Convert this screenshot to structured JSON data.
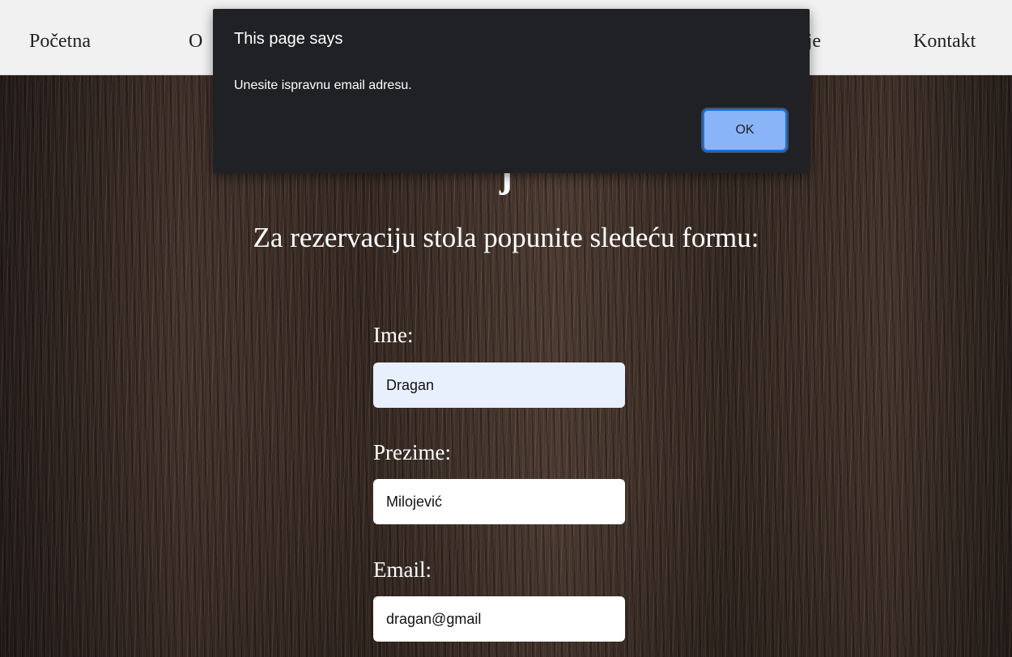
{
  "nav": {
    "items": [
      {
        "label": "Početna"
      },
      {
        "label": "O"
      },
      {
        "label": "ije"
      },
      {
        "label": "Kontakt"
      }
    ]
  },
  "page": {
    "title": "j",
    "subtitle": "Za rezervaciju stola popunite sledeću formu:"
  },
  "form": {
    "first_name": {
      "label": "Ime:",
      "value": "Dragan"
    },
    "last_name": {
      "label": "Prezime:",
      "value": "Milojević"
    },
    "email": {
      "label": "Email:",
      "value": "dragan@gmail"
    }
  },
  "alert": {
    "title": "This page says",
    "message": "Unesite ispravnu email adresu.",
    "ok_label": "OK"
  },
  "colors": {
    "nav_background": "#f1f1f1",
    "dialog_background": "#202124",
    "ok_button": "#8ab4f8",
    "autofill_field": "#e8f0fe"
  }
}
